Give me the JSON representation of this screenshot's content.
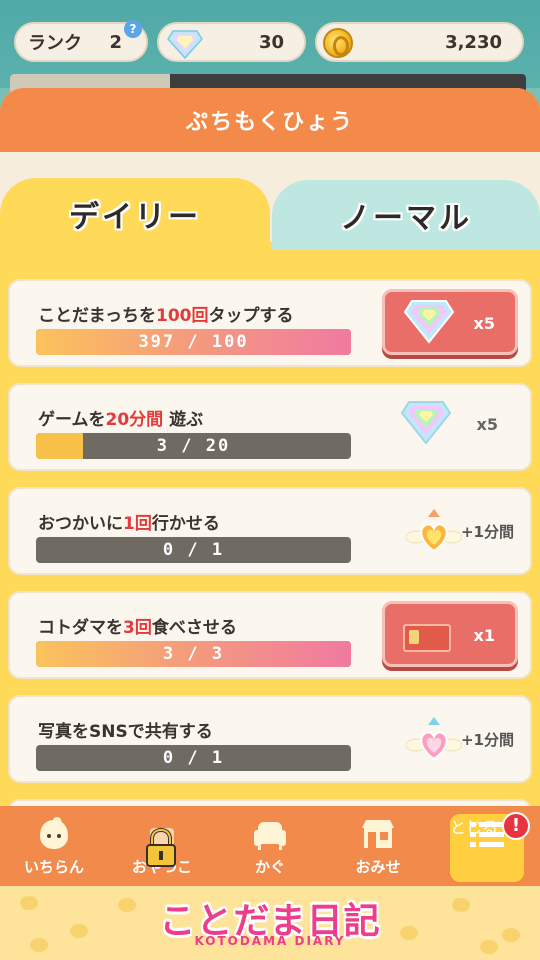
{
  "status": {
    "rank_label": "ランク",
    "rank_value": "2",
    "help": "?",
    "gems": "30",
    "coins": "3,230"
  },
  "panel": {
    "title": "ぷちもくひょう",
    "tabs": [
      {
        "label": "デイリー",
        "active": true
      },
      {
        "label": "ノーマル",
        "active": false
      }
    ]
  },
  "missions": [
    {
      "pre": "ことだまっちを",
      "hl": "100回",
      "post": "タップする",
      "progress_text": "397 / 100",
      "progress": 1.0,
      "reward_type": "gem",
      "reward": "x5",
      "claimable": true
    },
    {
      "pre": "ゲームを",
      "hl": "20分間",
      "post": " 遊ぶ",
      "progress_text": "3 / 20",
      "progress": 0.15,
      "reward_type": "gem",
      "reward": "x5",
      "claimable": false
    },
    {
      "pre": "おつかいに",
      "hl": "1回",
      "post": "行かせる",
      "progress_text": "0 / 1",
      "progress": 0,
      "reward_type": "heart-orange",
      "reward": "+1分間",
      "claimable": false
    },
    {
      "pre": "コトダマを",
      "hl": "3回",
      "post": "食べさせる",
      "progress_text": "3 / 3",
      "progress": 1.0,
      "reward_type": "ticket",
      "reward": "x1",
      "claimable": true
    },
    {
      "pre": "写真をSNSで共有する",
      "hl": "",
      "post": "",
      "progress_text": "0 / 1",
      "progress": 0,
      "reward_type": "heart-pink",
      "reward": "+1分間",
      "claimable": false
    }
  ],
  "nav": [
    {
      "label": "いちらん",
      "icon": "face-icon"
    },
    {
      "label": "おやつこ",
      "icon": "lock-icon"
    },
    {
      "label": "かぐ",
      "icon": "sofa-icon"
    },
    {
      "label": "おみせ",
      "icon": "shop-icon"
    },
    {
      "label": "とじる",
      "icon": "list-icon"
    }
  ],
  "alert": "!",
  "footer": {
    "logo": "ことだま日記",
    "logo_sub": "KOTODAMA DIARY"
  },
  "colors": {
    "header": "#f48a4a",
    "panel": "#ffd958",
    "reward_button": "#ea6e68",
    "highlight": "#e53a3a",
    "logo": "#ee3d8a"
  }
}
